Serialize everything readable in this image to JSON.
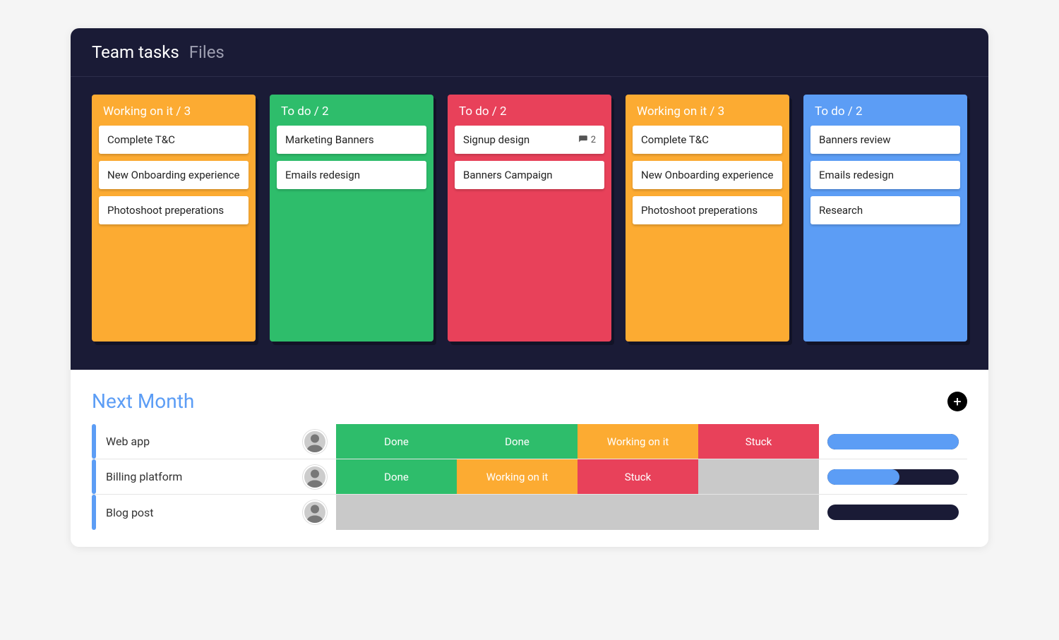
{
  "header": {
    "tab_active": "Team tasks",
    "tab_inactive": "Files"
  },
  "colors": {
    "orange": "#fcab32",
    "green": "#2ebd6b",
    "red": "#e8415a",
    "blue": "#5c9df5",
    "dark": "#1a1b36"
  },
  "board": {
    "columns": [
      {
        "title": "Working on it / 3",
        "color": "orange",
        "cards": [
          {
            "text": "Complete T&C"
          },
          {
            "text": "New Onboarding experience"
          },
          {
            "text": "Photoshoot preperations"
          }
        ]
      },
      {
        "title": "To do / 2",
        "color": "green",
        "cards": [
          {
            "text": "Marketing Banners"
          },
          {
            "text": "Emails redesign"
          }
        ]
      },
      {
        "title": "To do / 2",
        "color": "red",
        "cards": [
          {
            "text": "Signup design",
            "comments": 2
          },
          {
            "text": "Banners Campaign"
          }
        ]
      },
      {
        "title": "Working on it / 3",
        "color": "orange",
        "cards": [
          {
            "text": "Complete T&C"
          },
          {
            "text": "New Onboarding experience"
          },
          {
            "text": "Photoshoot preperations"
          }
        ]
      },
      {
        "title": "To do / 2",
        "color": "blue",
        "cards": [
          {
            "text": "Banners review"
          },
          {
            "text": "Emails redesign"
          },
          {
            "text": "Research"
          }
        ]
      }
    ]
  },
  "section": {
    "title": "Next Month",
    "add_icon": "plus-icon",
    "rows": [
      {
        "name": "Web app",
        "avatar": "person-1",
        "statuses": [
          {
            "label": "Done",
            "color": "green"
          },
          {
            "label": "Done",
            "color": "green"
          },
          {
            "label": "Working on it",
            "color": "orange"
          },
          {
            "label": "Stuck",
            "color": "red"
          }
        ],
        "progress": 100
      },
      {
        "name": "Billing platform",
        "avatar": "person-2",
        "statuses": [
          {
            "label": "Done",
            "color": "green"
          },
          {
            "label": "Working on it",
            "color": "orange"
          },
          {
            "label": "Stuck",
            "color": "red"
          },
          {
            "label": "",
            "color": "gray"
          }
        ],
        "progress": 55
      },
      {
        "name": "Blog post",
        "avatar": "person-3",
        "statuses": [
          {
            "label": "",
            "color": "gray"
          },
          {
            "label": "",
            "color": "gray"
          },
          {
            "label": "",
            "color": "gray"
          },
          {
            "label": "",
            "color": "gray"
          }
        ],
        "progress": 0
      }
    ]
  }
}
